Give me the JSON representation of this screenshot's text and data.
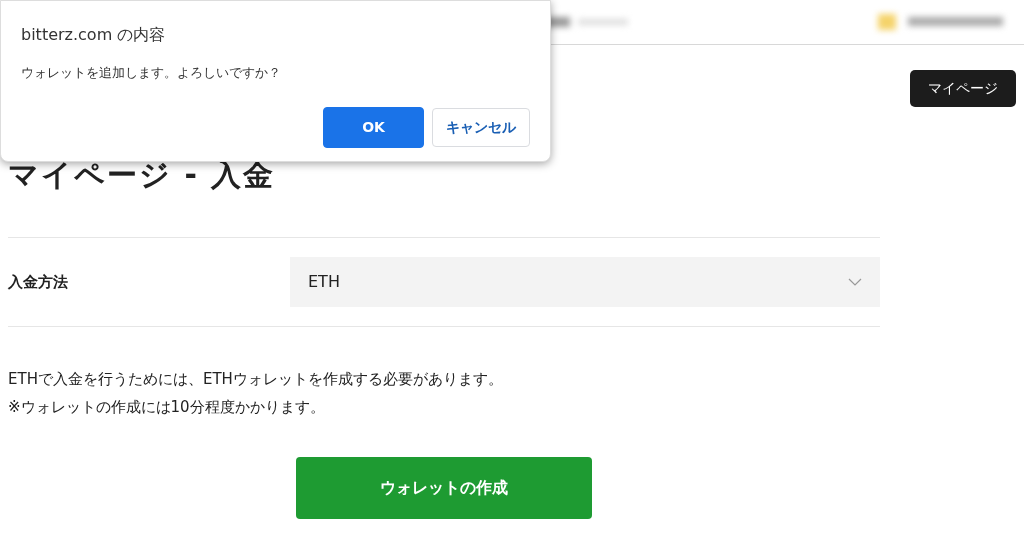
{
  "dialog": {
    "title": "bitterz.com の内容",
    "message": "ウォレットを追加します。よろしいですか？",
    "buttons": [
      {
        "label": "OK",
        "kind": "primary"
      },
      {
        "label": "キャンセル",
        "kind": "secondary"
      }
    ]
  },
  "header": {
    "mypage_button": "マイページ"
  },
  "page_title": "マイページ - 入金",
  "form": {
    "label": "入金方法",
    "select_value": "ETH"
  },
  "notes": [
    "ETHで入金を行うためには、ETHウォレットを作成する必要があります。",
    "※ウォレットの作成には10分程度かかります。"
  ],
  "create_button": "ウォレットの作成"
}
